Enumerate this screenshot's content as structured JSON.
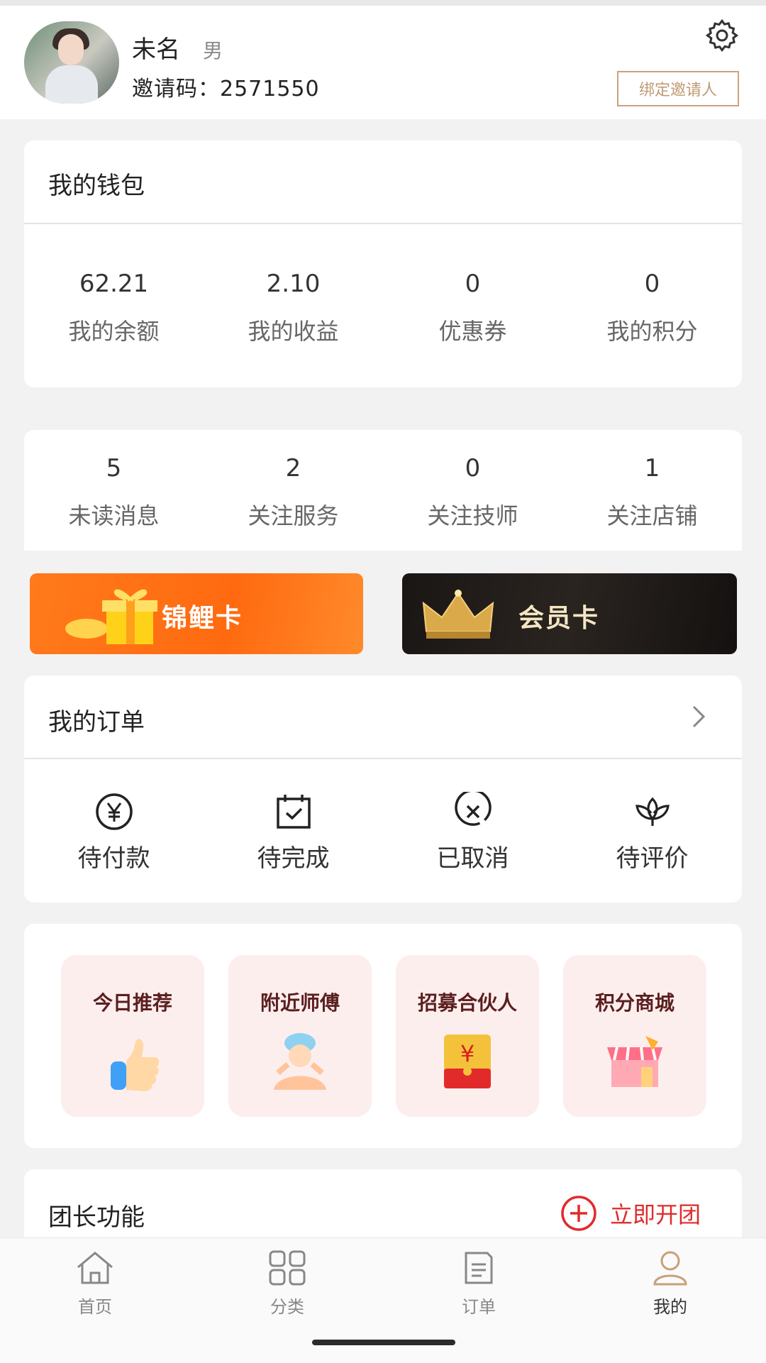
{
  "profile": {
    "name": "未名",
    "gender": "男",
    "invite_code": "邀请码：2571550",
    "bind_button": "绑定邀请人"
  },
  "wallet": {
    "title": "我的钱包",
    "stats": [
      {
        "value": "62.21",
        "label": "我的余额"
      },
      {
        "value": "2.10",
        "label": "我的收益"
      },
      {
        "value": "0",
        "label": "优惠券"
      },
      {
        "value": "0",
        "label": "我的积分"
      }
    ]
  },
  "follow": {
    "stats": [
      {
        "value": "5",
        "label": "未读消息"
      },
      {
        "value": "2",
        "label": "关注服务"
      },
      {
        "value": "0",
        "label": "关注技师"
      },
      {
        "value": "1",
        "label": "关注店铺"
      }
    ]
  },
  "banners": {
    "koi_card": "锦鲤卡",
    "vip_card": "会员卡"
  },
  "orders": {
    "title": "我的订单",
    "items": [
      {
        "label": "待付款",
        "icon": "yen-circle-icon"
      },
      {
        "label": "待完成",
        "icon": "calendar-check-icon"
      },
      {
        "label": "已取消",
        "icon": "cancel-circle-icon"
      },
      {
        "label": "待评价",
        "icon": "lotus-icon"
      }
    ]
  },
  "promo": {
    "tiles": [
      {
        "label": "今日推荐",
        "icon": "thumbs-up-icon"
      },
      {
        "label": "附近师傅",
        "icon": "spa-person-icon"
      },
      {
        "label": "招募合伙人",
        "icon": "red-envelope-icon"
      },
      {
        "label": "积分商城",
        "icon": "shop-icon"
      }
    ]
  },
  "leader": {
    "title": "团长功能",
    "action": "立即开团"
  },
  "tabbar": {
    "items": [
      {
        "label": "首页",
        "icon": "home-icon",
        "active": false
      },
      {
        "label": "分类",
        "icon": "grid-icon",
        "active": false
      },
      {
        "label": "订单",
        "icon": "document-icon",
        "active": false
      },
      {
        "label": "我的",
        "icon": "user-icon",
        "active": true
      }
    ]
  },
  "colors": {
    "accent_gold": "#c19a74",
    "action_red": "#e02b2b",
    "active_tab": "#c8a07a",
    "koi_orange": "#ff6a10",
    "vip_dark": "#1a1614"
  }
}
